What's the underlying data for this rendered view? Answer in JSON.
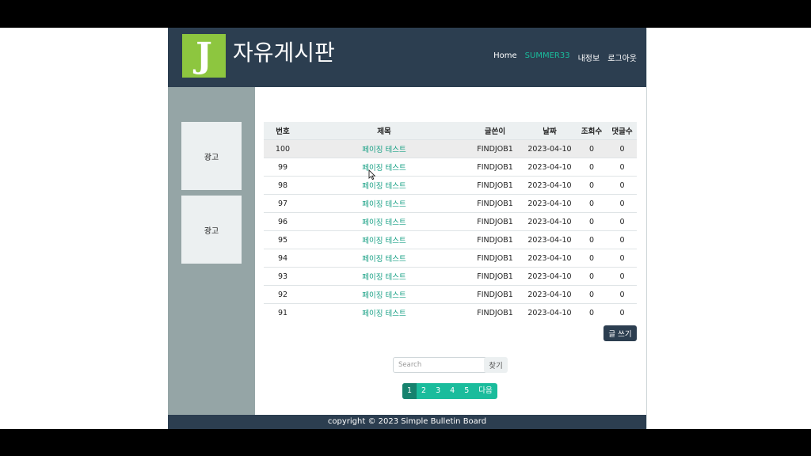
{
  "header": {
    "logo_letter": "J",
    "site_title": "자유게시판",
    "nav": [
      "Home",
      "SUMMER33",
      "내정보",
      "로그아웃"
    ]
  },
  "sidebar": {
    "ads": [
      "광고",
      "광고"
    ]
  },
  "table": {
    "columns": [
      "번호",
      "제목",
      "글쓴이",
      "날짜",
      "조회수",
      "댓글수"
    ],
    "rows": [
      [
        "100",
        "페이징 테스트",
        "FINDJOB1",
        "2023-04-10",
        "0",
        "0"
      ],
      [
        "99",
        "페이징 테스트",
        "FINDJOB1",
        "2023-04-10",
        "0",
        "0"
      ],
      [
        "98",
        "페이징 테스트",
        "FINDJOB1",
        "2023-04-10",
        "0",
        "0"
      ],
      [
        "97",
        "페이징 테스트",
        "FINDJOB1",
        "2023-04-10",
        "0",
        "0"
      ],
      [
        "96",
        "페이징 테스트",
        "FINDJOB1",
        "2023-04-10",
        "0",
        "0"
      ],
      [
        "95",
        "페이징 테스트",
        "FINDJOB1",
        "2023-04-10",
        "0",
        "0"
      ],
      [
        "94",
        "페이징 테스트",
        "FINDJOB1",
        "2023-04-10",
        "0",
        "0"
      ],
      [
        "93",
        "페이징 테스트",
        "FINDJOB1",
        "2023-04-10",
        "0",
        "0"
      ],
      [
        "92",
        "페이징 테스트",
        "FINDJOB1",
        "2023-04-10",
        "0",
        "0"
      ],
      [
        "91",
        "페이징 테스트",
        "FINDJOB1",
        "2023-04-10",
        "0",
        "0"
      ]
    ]
  },
  "write_button": "글 쓰기",
  "search": {
    "placeholder": "Search",
    "button": "찾기"
  },
  "pagination": {
    "pages": [
      "1",
      "2",
      "3",
      "4",
      "5"
    ],
    "active": "1",
    "next": "다음"
  },
  "footer": "copyright © 2023 Simple Bulletin Board",
  "colors": {
    "header_bg": "#2c3e50",
    "accent": "#1abc9c",
    "logo_bg": "#8dc63f",
    "sidebar_bg": "#95a5a6"
  },
  "icons": {
    "cursor": "mouse-cursor-icon"
  }
}
